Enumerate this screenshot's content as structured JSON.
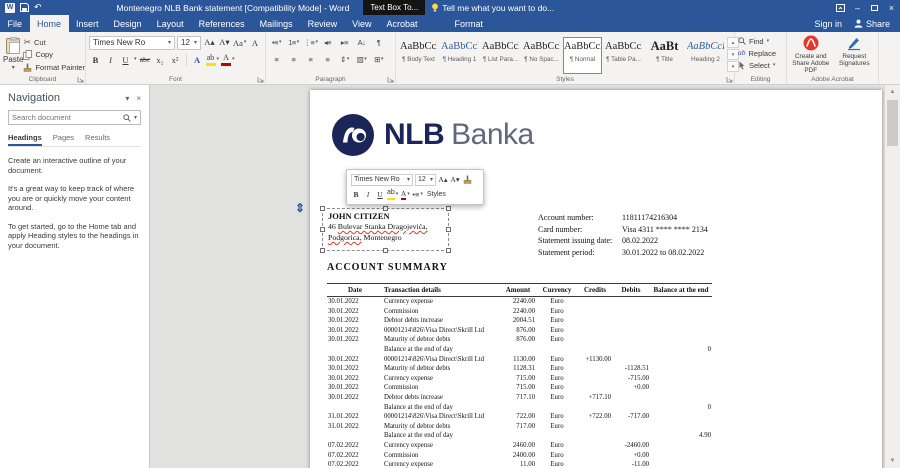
{
  "titlebar": {
    "app_title": "Montenegro NLB Bank statement [Compatibility Mode] - Word",
    "contextual_group": "Text Box To...",
    "tell_me": "Tell me what you want to do...",
    "sign_in": "Sign in",
    "share": "Share"
  },
  "ribbon": {
    "tabs": [
      {
        "label": "File"
      },
      {
        "label": "Home",
        "active": true
      },
      {
        "label": "Insert"
      },
      {
        "label": "Design"
      },
      {
        "label": "Layout"
      },
      {
        "label": "References"
      },
      {
        "label": "Mailings"
      },
      {
        "label": "Review"
      },
      {
        "label": "View"
      },
      {
        "label": "Acrobat"
      }
    ],
    "contextual_tab": "Format",
    "groups": {
      "clipboard": {
        "label": "Clipboard",
        "paste": "Paste",
        "cut": "Cut",
        "copy": "Copy",
        "format_painter": "Format Painter"
      },
      "font": {
        "label": "Font",
        "family": "Times New Ro",
        "size": "12"
      },
      "paragraph": {
        "label": "Paragraph"
      },
      "styles": {
        "label": "Styles",
        "items": [
          {
            "preview": "AaBbCcDc",
            "name": "¶ Body Text"
          },
          {
            "preview": "AaBbCcDc",
            "name": "¶ Heading 1",
            "heading": true
          },
          {
            "preview": "AaBbCcL",
            "name": "¶ List Para..."
          },
          {
            "preview": "AaBbCcL",
            "name": "¶ No Spac..."
          },
          {
            "preview": "AaBbCcL",
            "name": "¶ Normal",
            "selected": true
          },
          {
            "preview": "AaBbCcL",
            "name": "¶ Table Pa..."
          },
          {
            "preview": "AaBt",
            "name": "¶ Title",
            "big": true
          },
          {
            "preview": "AaBbCcI",
            "name": "Heading 2",
            "heading": true,
            "italic": true
          }
        ]
      },
      "editing": {
        "label": "Editing",
        "find": "Find",
        "replace": "Replace",
        "select": "Select"
      },
      "acrobat": {
        "label": "Adobe Acrobat",
        "create_pdf": "Create and Share Adobe PDF",
        "request_signatures": "Request Signatures"
      }
    }
  },
  "navigation": {
    "title": "Navigation",
    "search_placeholder": "Search document",
    "tabs": [
      {
        "label": "Headings",
        "active": true
      },
      {
        "label": "Pages"
      },
      {
        "label": "Results"
      }
    ],
    "body": [
      "Create an interactive outline of your document.",
      "It's a great way to keep track of where you are or quickly move your content around.",
      "To get started, go to the Home tab and apply Heading styles to the headings in your document."
    ]
  },
  "mini_toolbar": {
    "font": "Times New Ro",
    "size": "12",
    "styles_label": "Styles"
  },
  "document": {
    "logo": {
      "bold": "NLB",
      "light": "Banka"
    },
    "recipient": {
      "name": "JOHN CITIZEN",
      "address_line1_prefix": "46 ",
      "address_line1_spell": "Bulevar Stanka Dragojevića,",
      "address_line2_spell": "Podgorica,",
      "address_line2_suffix": " Montenegro"
    },
    "meta": [
      {
        "label": "Account number:",
        "value": "11811174216304"
      },
      {
        "label": "Card number:",
        "value": "Visa 4311 **** **** 2134"
      },
      {
        "label": "Statement issuing date:",
        "value": "08.02.2022"
      },
      {
        "label": "Statement period:",
        "value": "30.01.2022 to 08.02.2022"
      }
    ],
    "section_title": "ACCOUNT SUMMARY",
    "table": {
      "headers": [
        "Date",
        "Transaction details",
        "Amount",
        "Currency",
        "Credits",
        "Debits",
        "Balance at the end"
      ],
      "rows": [
        [
          "30.01.2022",
          "Currency expense",
          "2240.00",
          "Euro",
          "",
          "",
          ""
        ],
        [
          "30.01.2022",
          "Commission",
          "2240.00",
          "Euro",
          "",
          "",
          ""
        ],
        [
          "30.01.2022",
          "Debtor debts increase",
          "2004.51",
          "Euro",
          "",
          "",
          ""
        ],
        [
          "30.01.2022",
          "00001214\\826\\Visa Direct\\Skrill Ltd",
          "876.00",
          "Euro",
          "",
          "",
          ""
        ],
        [
          "30.01.2022",
          "Maturity of debtor debts",
          "876.00",
          "Euro",
          "",
          "",
          ""
        ],
        [
          "",
          "Balance at the end of day",
          "",
          "",
          "",
          "",
          "0"
        ],
        [
          "30.01.2022",
          "00001214\\826\\Visa Direct\\Skrill Ltd",
          "1130.00",
          "Euro",
          "+1130.00",
          "",
          ""
        ],
        [
          "30.01.2022",
          "Maturity of debtor debts",
          "1128.31",
          "Euro",
          "",
          "-1128.51",
          ""
        ],
        [
          "30.01.2022",
          "Currency expense",
          "715.00",
          "Euro",
          "",
          "-715.00",
          ""
        ],
        [
          "30.01.2022",
          "Commission",
          "715.00",
          "Euro",
          "",
          "+0.00",
          ""
        ],
        [
          "30.01.2022",
          "Debtor debts increase",
          "717.10",
          "Euro",
          "+717.10",
          "",
          ""
        ],
        [
          "",
          "Balance at the end of day",
          "",
          "",
          "",
          "",
          "0"
        ],
        [
          "31.01.2022",
          "00001214\\826\\Visa Direct\\Skrill Ltd",
          "722.00",
          "Euro",
          "+722.00",
          "-717.00",
          ""
        ],
        [
          "31.01.2022",
          "Maturity of debtor debts",
          "717.00",
          "Euro",
          "",
          "",
          ""
        ],
        [
          "",
          "Balance at the end of day",
          "",
          "",
          "",
          "",
          "4.90"
        ],
        [
          "07.02.2022",
          "Currency expense",
          "2460.00",
          "Euro",
          "",
          "-2460.00",
          ""
        ],
        [
          "07.02.2022",
          "Commission",
          "2400.00",
          "Euro",
          "",
          "+0.00",
          ""
        ],
        [
          "07.02.2022",
          "Currency expense",
          "11.00",
          "Euro",
          "",
          "-11.00",
          ""
        ]
      ]
    }
  },
  "icons": {
    "word": "W",
    "undo": "↶",
    "close": "×",
    "minimize": "–",
    "caret_down": "▾",
    "scissors": "✂",
    "bold": "B",
    "italic": "I",
    "underline": "U",
    "strike": "abc",
    "subscript": "x₂",
    "superscript": "x²",
    "grow": "A▴",
    "shrink": "A▾",
    "change_case": "Aa",
    "clear_format": "A",
    "effects": "A",
    "highlight": "ab",
    "fontcolor": "A",
    "bullets": "•≡",
    "numbering": "1≡",
    "multilevel": "⋮≡",
    "outdent": "◂≡",
    "indent": "▸≡",
    "sort": "A↓",
    "pilcrow": "¶",
    "align": "≡",
    "spacing": "⇕",
    "shading": "▨",
    "borders": "⊞",
    "replace_glyph": "ab",
    "gallery_up": "▴",
    "gallery_down": "▾",
    "gallery_more": "▾",
    "scroll_up": "▲",
    "scroll_down": "▼",
    "anchor": "⇕"
  },
  "colors": {
    "accent": "#2b579a",
    "logo_navy": "#1b2558",
    "highlight_yellow": "#ffe100",
    "font_color_red": "#c00000",
    "spell_red": "#e0342b"
  }
}
